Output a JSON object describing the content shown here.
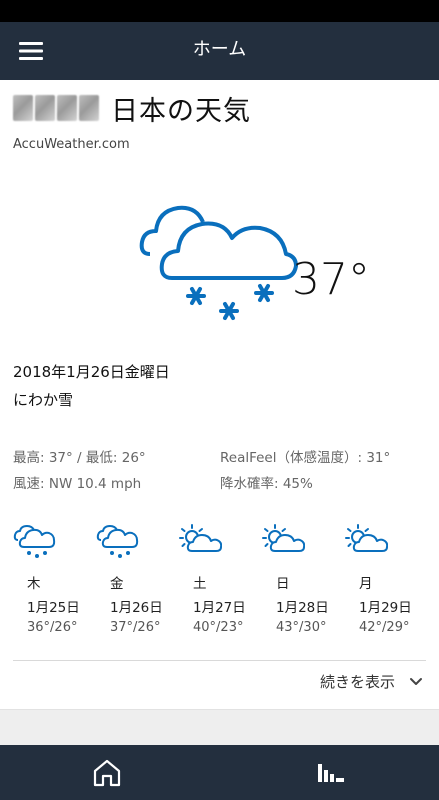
{
  "app_bar": {
    "title": "ホーム"
  },
  "location": {
    "title": "日本の天気",
    "source": "AccuWeather.com"
  },
  "current": {
    "icon": "snow-cloud-icon",
    "temperature": "37°",
    "date": "2018年1月26日金曜日",
    "condition": "にわか雪",
    "high_low": "最高: 37° / 最低: 26°",
    "realfeel": "RealFeel（体感温度）: 31°",
    "wind": "風速: NW  10.4 mph",
    "precip": "降水確率: 45%"
  },
  "forecast": [
    {
      "dow": "木",
      "date": "1月25日",
      "hi_lo": "36°/26°",
      "icon": "snow-cloud-icon"
    },
    {
      "dow": "金",
      "date": "1月26日",
      "hi_lo": "37°/26°",
      "icon": "snow-cloud-icon"
    },
    {
      "dow": "土",
      "date": "1月27日",
      "hi_lo": "40°/23°",
      "icon": "partly-sunny-icon"
    },
    {
      "dow": "日",
      "date": "1月28日",
      "hi_lo": "43°/30°",
      "icon": "partly-sunny-icon"
    },
    {
      "dow": "月",
      "date": "1月29日",
      "hi_lo": "42°/29°",
      "icon": "partly-sunny-icon"
    }
  ],
  "show_more": {
    "label": "続きを表示"
  },
  "colors": {
    "accent": "#0a6fbd",
    "bar": "#232f3e"
  }
}
